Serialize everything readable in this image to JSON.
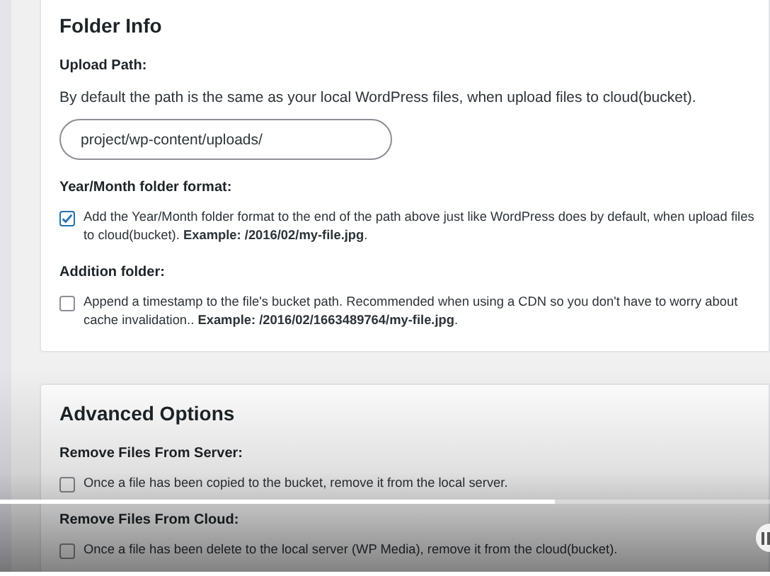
{
  "sections": [
    {
      "title": "Folder Info",
      "fields": [
        {
          "kind": "text",
          "label": "Upload Path:",
          "description": "By default the path is the same as your local WordPress files, when upload files to cloud(bucket).",
          "value": "project/wp-content/uploads/"
        },
        {
          "kind": "checkbox",
          "label": "Year/Month folder format:",
          "checked": true,
          "text": "Add the Year/Month folder format to the end of the path above just like WordPress does by default, when upload files to cloud(bucket). **Example: /2016/02/my-file.jpg**."
        },
        {
          "kind": "checkbox",
          "label": "Addition folder:",
          "checked": false,
          "text": "Append a timestamp to the file's bucket path. Recommended when using a CDN so you don't have to worry about cache invalidation.. **Example: /2016/02/1663489764/my-file.jpg**."
        }
      ]
    },
    {
      "title": "Advanced Options",
      "fields": [
        {
          "kind": "checkbox",
          "label": "Remove Files From Server:",
          "checked": false,
          "text": "Once a file has been copied to the bucket, remove it from the local server."
        },
        {
          "kind": "checkbox",
          "label": "Remove Files From Cloud:",
          "checked": false,
          "text": "Once a file has been delete to the local server (WP Media), remove it from the cloud(bucket)."
        }
      ]
    }
  ],
  "video_player": {
    "level": 0.72
  }
}
